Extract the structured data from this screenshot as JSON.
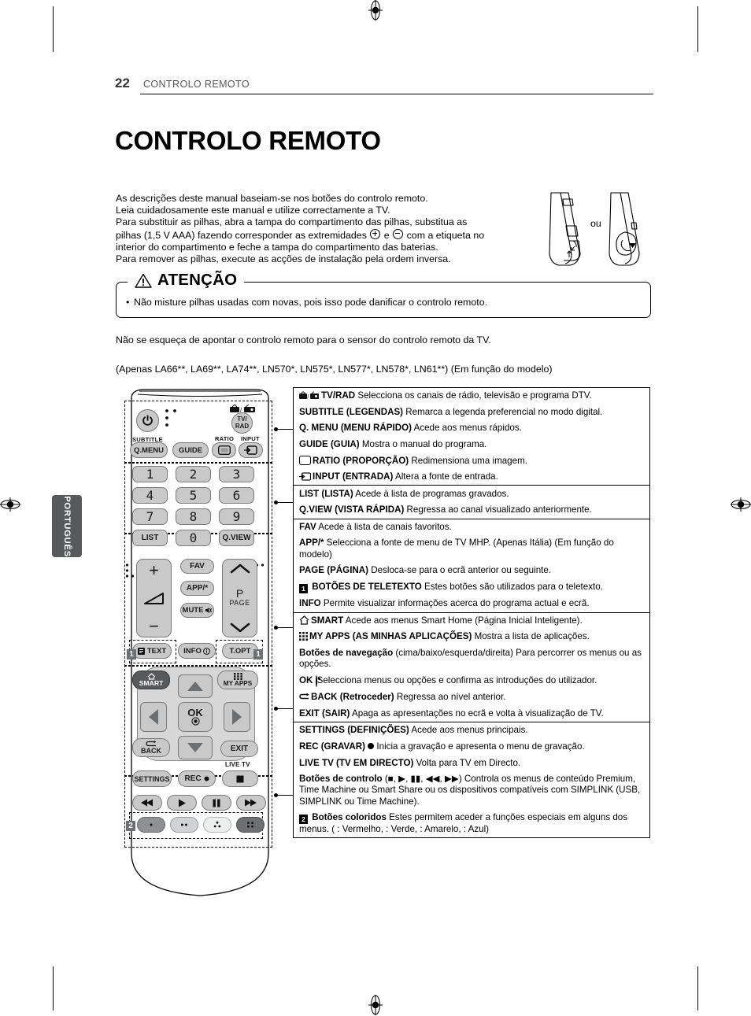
{
  "header": {
    "page_number": "22",
    "breadcrumb": "CONTROLO REMOTO"
  },
  "page_title": "CONTROLO REMOTO",
  "side_tab": {
    "label": "PORTUGUÊS"
  },
  "intro": {
    "line1": "As descrições deste manual baseiam-se nos botões do controlo remoto.",
    "line2": "Leia cuidadosamente este manual e utilize correctamente a TV.",
    "line3": "Para substituir as pilhas, abra a tampa do compartimento das pilhas, substitua as",
    "line4a": "pilhas (1,5 V AAA) fazendo corresponder as extremidades",
    "line4b": "e",
    "line4c": "com a etiqueta no",
    "line5": "interior do compartimento e feche a tampa do compartimento das baterias.",
    "line6": "Para remover as pilhas, execute as acções de instalação pela ordem inversa."
  },
  "battery_illustration": {
    "separator_label": "ou"
  },
  "caution": {
    "heading": "ATENÇÃO",
    "bullet": "Não misture pilhas usadas com novas, pois isso pode danificar o controlo remoto."
  },
  "note_sensor": "Não se esqueça de apontar o controlo remoto para o sensor do controlo remoto da TV.",
  "note_models": "(Apenas   LA66**, LA69**, LA74**, LN570*, LN575*, LN577*, LN578*, LN61**) (Em função do modelo)",
  "remote": {
    "buttons": {
      "power": "power-icon",
      "tv_rad_top": "tv-radio-icon",
      "tv_rad": "TV/\nRAD",
      "subtitle_label": "SUBTITLE",
      "q_menu": "Q.MENU",
      "guide": "GUIDE",
      "ratio_label": "RATIO",
      "input_label": "INPUT",
      "n1": "1",
      "n2": "2",
      "n3": "3",
      "n4": "4",
      "n5": "5",
      "n6": "6",
      "n7": "7",
      "n8": "8",
      "n9": "9",
      "list": "LIST",
      "n0": "0",
      "qview": "Q.VIEW",
      "vol_plus": "+",
      "vol_minus": "−",
      "fav": "FAV",
      "app": "APP/*",
      "mute": "MUTE",
      "page_p": "P",
      "page_label": "PAGE",
      "text": "TEXT",
      "info": "INFO",
      "topt": "T.OPT",
      "smart": "SMART",
      "my_apps": "MY APPS",
      "ok": "OK",
      "back": "BACK",
      "exit": "EXIT",
      "live_tv": "LIVE TV",
      "settings": "SETTINGS",
      "rec": "REC",
      "tag1": "1",
      "tag2": "2"
    }
  },
  "table": {
    "groups": [
      {
        "rows": [
          {
            "icon": "tv-radio-icon",
            "bold": "TV/RAD",
            "text": " Selecciona os canais de rádio, televisão e programa DTV."
          },
          {
            "bold": "SUBTITLE (LEGENDAS)",
            "text": " Remarca a legenda preferencial no modo digital."
          },
          {
            "bold": "Q. MENU (MENU RÁPIDO)",
            "text": " Acede aos menus rápidos."
          },
          {
            "bold": "GUIDE (GUIA)",
            "text": " Mostra o manual do programa."
          },
          {
            "icon": "ratio-icon",
            "bold": "RATIO (PROPORÇÃO)",
            "text": " Redimensiona uma imagem."
          },
          {
            "icon": "input-icon",
            "bold": "INPUT (ENTRADA)",
            "text": " Altera a fonte de entrada."
          }
        ]
      },
      {
        "rows": [
          {
            "bold": "LIST (LISTA)",
            "text": " Acede à lista de programas gravados."
          },
          {
            "bold": "Q.VIEW (VISTA RÁPIDA)",
            "text": " Regressa ao canal visualizado anteriormente."
          }
        ]
      },
      {
        "rows": [
          {
            "bold": "FAV",
            "text": " Acede à lista de canais favoritos."
          },
          {
            "bold": "APP/*",
            "text": " Selecciona a fonte de menu de TV MHP. (Apenas Itália) (Em função do modelo)"
          },
          {
            "bold": "PAGE (PÁGINA)",
            "text": " Desloca-se para o ecrã anterior ou seguinte."
          },
          {
            "icon": "tele-1-icon",
            "bold": "BOTÕES DE TELETEXTO",
            "text": " Estes botões são utilizados para o teletexto."
          },
          {
            "bold": "INFO",
            "text": " Permite visualizar informações acerca do programa actual e ecrã."
          }
        ]
      },
      {
        "rows": [
          {
            "icon": "home-icon",
            "bold": "SMART",
            "text": " Acede aos menus Smart Home (Página Inicial Inteligente)."
          },
          {
            "icon": "apps-grid-icon",
            "bold": "MY APPS (AS MINHAS APLICAÇÕES)",
            "text": " Mostra a lista de aplicações."
          },
          {
            "bold": "Botões de navegação",
            "text": " (cima/baixo/esquerda/direita) Para percorrer os menus ou as opções."
          },
          {
            "bold": "OK",
            "icon_after": "ok-icon",
            "text": " Selecciona menus ou opções e confirma as introduções do utilizador."
          },
          {
            "icon": "back-arrow-icon",
            "bold": "BACK (Retroceder)",
            "text": " Regressa ao nível anterior."
          },
          {
            "bold": "EXIT (SAIR)",
            "text": "  Apaga as apresentações no ecrã e volta à visualização de TV."
          }
        ]
      },
      {
        "rows": [
          {
            "bold": "SETTINGS (DEFINIÇÕES)",
            "text": " Acede aos menus principais."
          },
          {
            "bold": "REC (GRAVAR)",
            "icon_after": "rec-dot-icon",
            "text": " Inicia a gravação e apresenta o menu de gravação."
          },
          {
            "bold": "LIVE TV (TV EM DIRECTO)",
            "text": " Volta para TV em Directo."
          },
          {
            "bold": "Botões de controlo",
            "text": " (■, ▶, ▮▮, ◀◀, ▶▶) Controla os menus de conteúdo Premium, Time Machine ou Smart Share ou os dispositivos compatíveis com SIMPLINK (USB, SIMPLINK ou Time Machine)."
          },
          {
            "icon": "tele-2-icon",
            "bold": "Botões coloridos",
            "text": " Estes permitem aceder a funções especiais em alguns dos menus. (   : Vermelho,    : Verde,    : Amarelo,    : Azul)"
          }
        ]
      }
    ]
  },
  "colors": {
    "button_grey": "#c9c9c9",
    "button_dark": "#58595b",
    "tab_grey": "#58595b",
    "ink": "#000000"
  }
}
